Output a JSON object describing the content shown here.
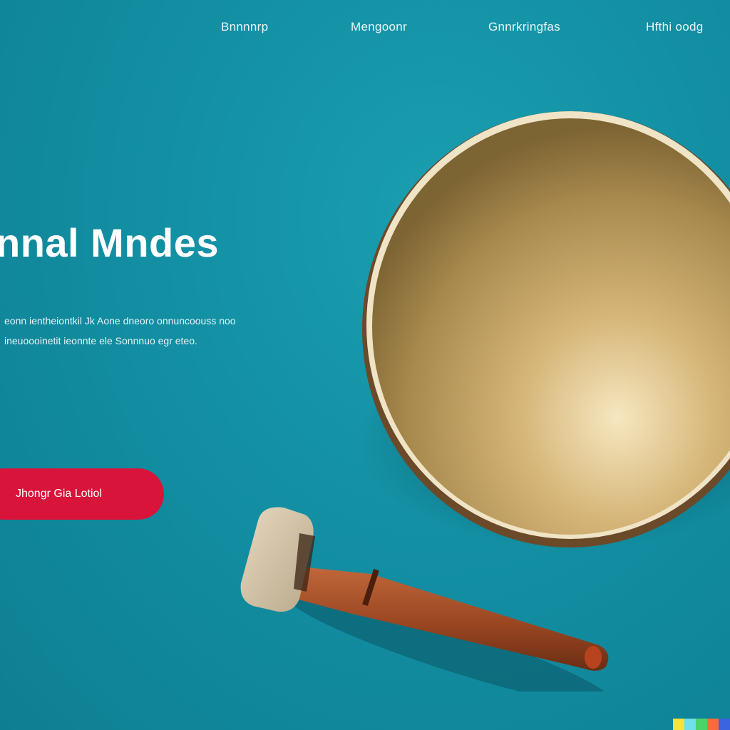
{
  "nav": {
    "items": [
      {
        "label": "Bnnnnrp"
      },
      {
        "label": "Mengoonr"
      },
      {
        "label": "Gnnrkringfas"
      },
      {
        "label": "Hfthi oodg"
      }
    ]
  },
  "hero": {
    "title": "nnal Mndes",
    "text_line1": "eonn ientheiontkil Jk Aone dneoro onnuncoouss noo",
    "text_line2": "ineuoooinetit ieonnte ele Sonnnuo egr eteo."
  },
  "cta": {
    "label": "Jhongr Gia Lotiol"
  },
  "image": {
    "bowl_icon": "singing-bowl",
    "mallet_icon": "mallet"
  },
  "colors": {
    "background": "#138fa3",
    "accent": "#d8143a",
    "text": "#ffffff",
    "bowl_gold": "#c9a862"
  },
  "color_strip": [
    "#f7e13b",
    "#6fe0e8",
    "#4bd36a",
    "#ff6a3a",
    "#3b64e0"
  ]
}
